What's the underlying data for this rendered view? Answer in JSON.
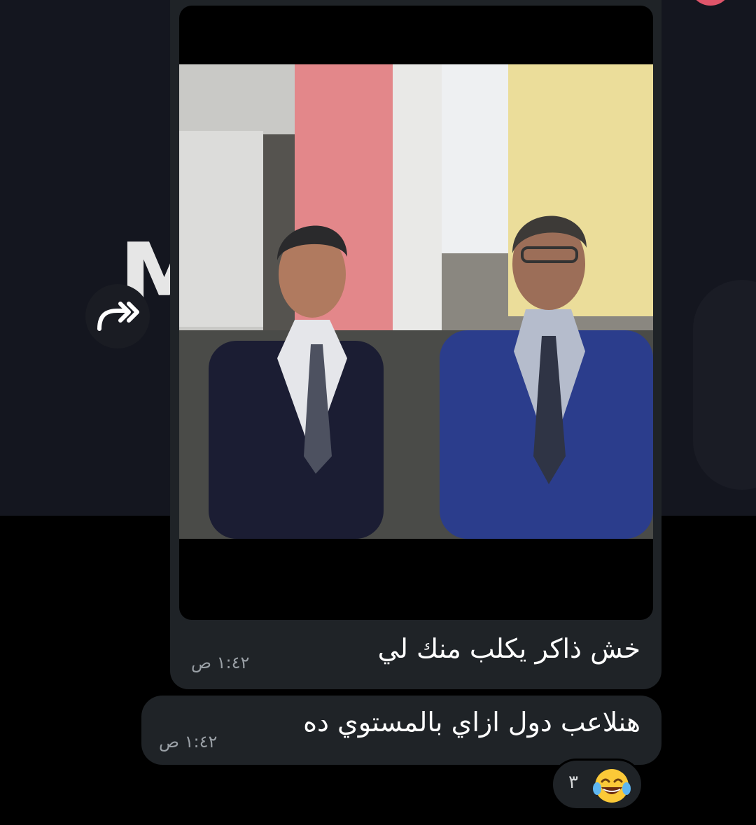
{
  "background": {
    "watermark_text": "M",
    "top_color": "#14161f",
    "bottom_color": "#000000"
  },
  "forward_button": {
    "icon": "forward-icon"
  },
  "messages": [
    {
      "type": "image",
      "caption": "خش ذاكر يكلب منك لي",
      "time": "١:٤٢ ص",
      "bubble_color": "#1f2327"
    },
    {
      "type": "text",
      "text": "هنلاعب دول ازاي بالمستوي ده",
      "time": "١:٤٢ ص",
      "reaction": {
        "emoji": "face-with-tears-of-joy-icon",
        "count": "٣"
      }
    }
  ]
}
